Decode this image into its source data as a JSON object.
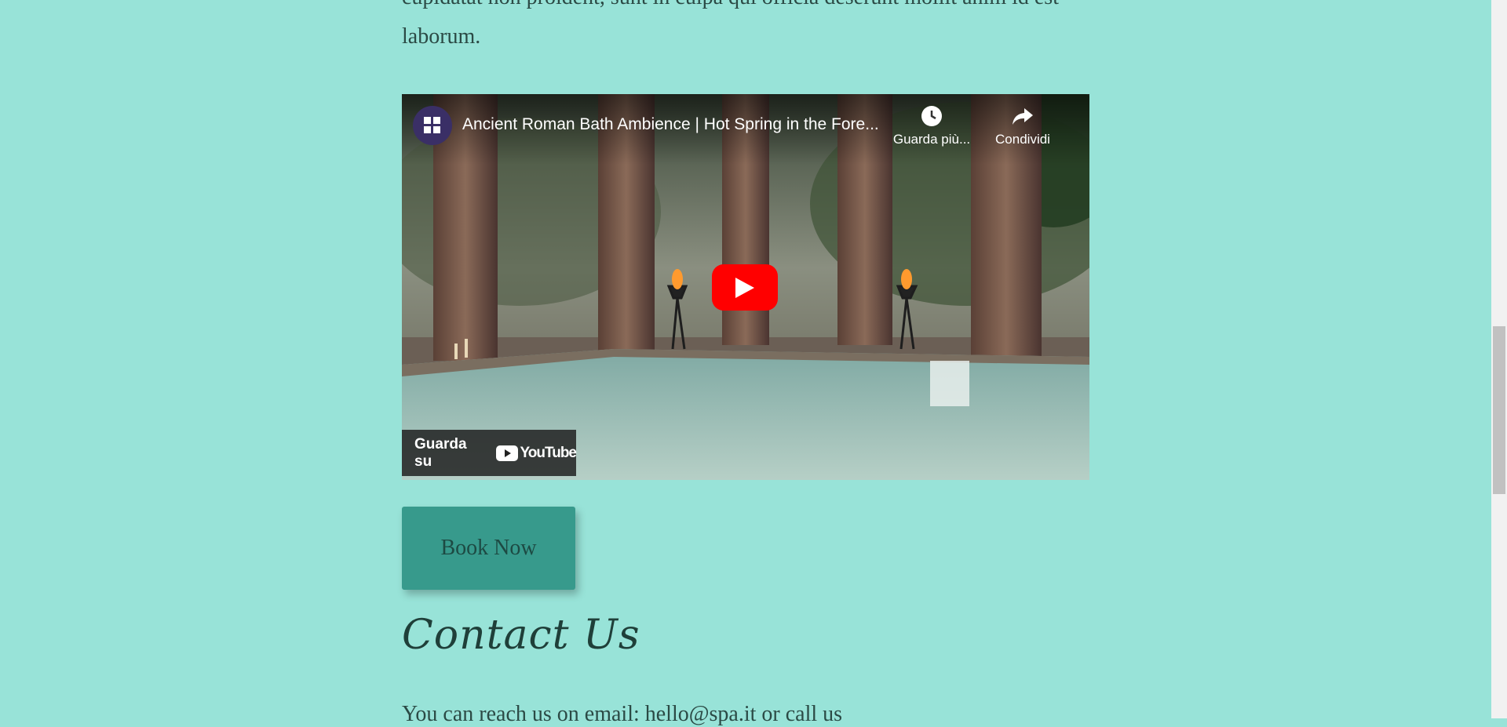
{
  "intro": {
    "text": "cupidatat non proident, sunt in culpa qui officia deserunt mollit anim id est laborum."
  },
  "video": {
    "title": "Ancient Roman Bath Ambience | Hot Spring in the Fore...",
    "watch_later_label": "Guarda più...",
    "share_label": "Condividi",
    "watch_on_label": "Guarda su",
    "youtube_wordmark": "YouTube",
    "play_color": "#ff0000"
  },
  "book_button": {
    "label": "Book Now",
    "color": "#379a8c"
  },
  "contact": {
    "heading": "Contact Us",
    "text": "You can reach us on email: hello@spa.it or call us"
  },
  "theme": {
    "background": "#98e3d8"
  }
}
